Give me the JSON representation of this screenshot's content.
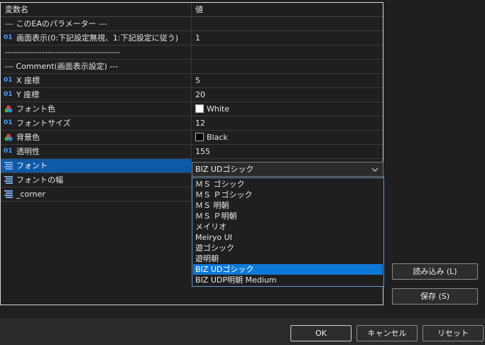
{
  "table": {
    "header": {
      "name": "変数名",
      "value": "値"
    },
    "rows": [
      {
        "name": "--- このEAのパラメーター ---",
        "value": ""
      },
      {
        "name": "画面表示(0:下記設定無視、1:下記設定に従う)",
        "value": "1",
        "icon": "int-01-icon"
      },
      {
        "name": "-----------------------------------------",
        "value": ""
      },
      {
        "name": "--- Comment(画面表示設定) ---",
        "value": ""
      },
      {
        "name": "X 座標",
        "value": "5",
        "icon": "int-01-icon"
      },
      {
        "name": "Y 座標",
        "value": "20",
        "icon": "int-01-icon"
      },
      {
        "name": "フォント色",
        "value": "White",
        "icon": "color-icon",
        "swatch": "#ffffff"
      },
      {
        "name": "フォントサイズ",
        "value": "12",
        "icon": "int-01-icon"
      },
      {
        "name": "背景色",
        "value": "Black",
        "icon": "color-icon",
        "swatch": "#000000"
      },
      {
        "name": "透明性",
        "value": "155",
        "icon": "int-01-icon"
      },
      {
        "name": "フォント",
        "value": "BIZ UDゴシック",
        "icon": "enum-icon"
      },
      {
        "name": "フォントの幅",
        "value": "",
        "icon": "enum-icon"
      },
      {
        "name": "_corner",
        "value": "",
        "icon": "enum-icon"
      }
    ]
  },
  "dropdown": {
    "selected": "BIZ UDゴシック",
    "options": [
      "ＭＳ ゴシック",
      "ＭＳ Ｐゴシック",
      "ＭＳ 明朝",
      "ＭＳ Ｐ明朝",
      "メイリオ",
      "Meiryo UI",
      "遊ゴシック",
      "遊明朝",
      "BIZ UDゴシック",
      "BIZ UDP明朝 Medium"
    ]
  },
  "side_buttons": {
    "load": "読み込み (L)",
    "save": "保存 (S)"
  },
  "bottom_buttons": {
    "ok": "OK",
    "cancel": "キャンセル",
    "reset": "リセット"
  },
  "colors": {
    "selection": "#0e5aa8",
    "dropdown_highlight": "#0e78d7",
    "int_icon": "#4aa0ff"
  }
}
